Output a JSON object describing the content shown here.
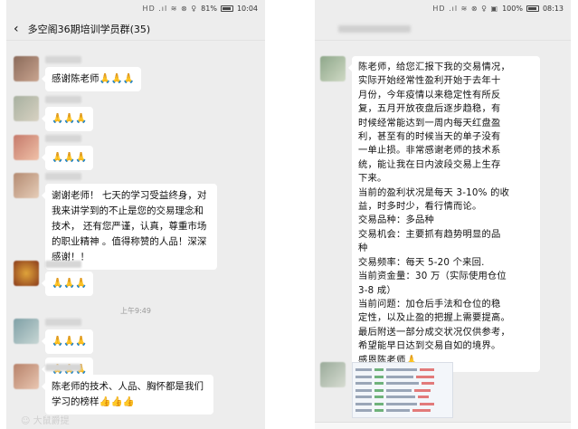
{
  "left": {
    "status": {
      "signal": "HD .ıl ≋ ⊗ ♀",
      "battery": "81%",
      "time": "10:04"
    },
    "header": {
      "back_icon": "‹",
      "title": "多空阁36期培训学员群(35)"
    },
    "messages": [
      {
        "text": "感谢陈老师🙏🙏🙏"
      },
      {
        "text": "🙏🙏🙏"
      },
      {
        "text": "🙏🙏🙏"
      },
      {
        "text": "谢谢老师！ 七天的学习受益终身，对我来讲学到的不止是您的交易理念和技术， 还有您严谨，认真，尊重市场的职业精神 。值得称赞的人品！深深感谢！！"
      },
      {
        "text": "🙏🙏🙏"
      },
      {
        "text": "🙏🙏🙏"
      },
      {
        "text": "🙏🙏🙏"
      },
      {
        "text": "陈老师的技术、人品、胸怀都是我们学习的榜样👍👍👍"
      }
    ],
    "time_divider": "上午9:49",
    "watermark": "☺ 大鼠爵提"
  },
  "right": {
    "status": {
      "signal": "HD .ıl ≋ ⊗ ♀ ▣",
      "battery": "100%",
      "time": "08:13"
    },
    "message_lines": [
      "陈老师，给您汇报下我的交易情况，",
      "实际开始经常性盈利开始于去年十",
      "月份，今年疫情以来稳定性有所反",
      "复，五月开放夜盘后逐步趋稳，有",
      "时候经常能达到一周内每天红盘盈",
      "利，甚至有的时候当天的单子没有",
      "一单止损。非常感谢老师的技术系",
      "统，能让我在日内波段交易上生存",
      "下来。",
      "当前的盈利状况是每天 3-10% 的收",
      "益，时多时少，看行情而论。",
      "交易品种：多品种",
      "交易机会：主要抓有趋势明显的品",
      "种",
      "交易频率：每天 5-20 个来回.",
      "当前资金量：30 万（实际使用仓位",
      "3-8 成）",
      "当前问题：加仓后手法和仓位的稳",
      "定性，以及止盈的把握上需要提高。",
      "最后附送一部分成交状况仅供参考，",
      "希望能早日达到交易自如的境界。",
      "感恩陈老师🙏"
    ]
  },
  "colors": {
    "background": "#ededed",
    "bubble": "#ffffff",
    "text": "#111111"
  },
  "icons": [
    "back-icon",
    "battery-icon",
    "signal-icon",
    "avatar"
  ]
}
